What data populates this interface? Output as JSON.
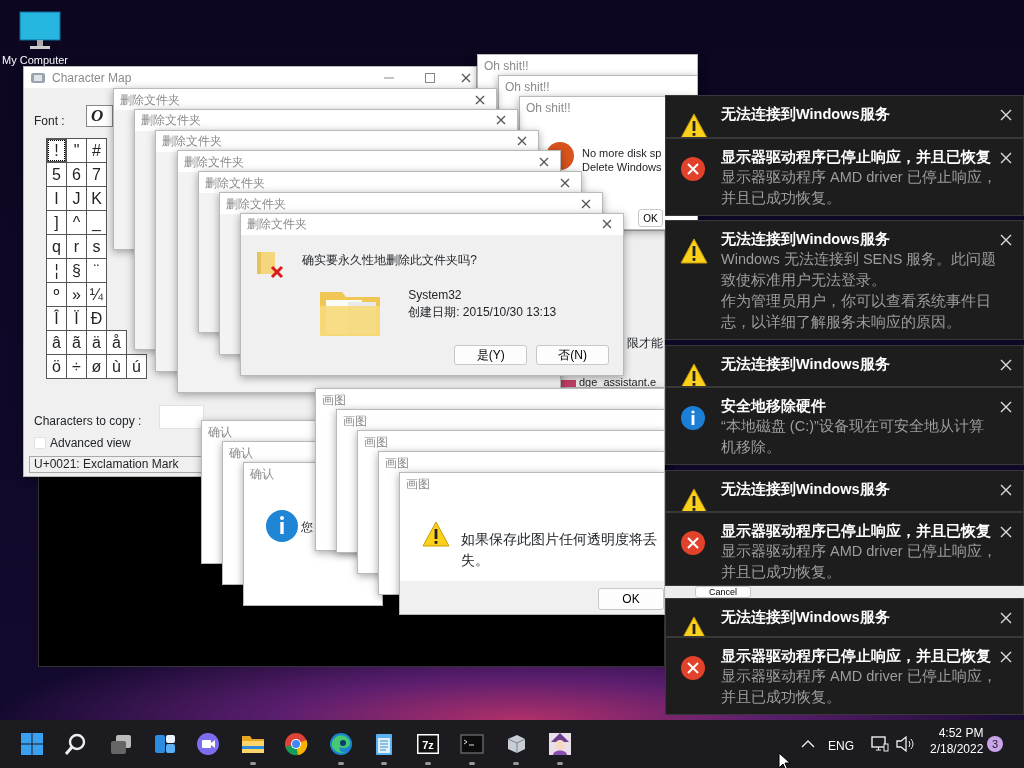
{
  "desktop_icon": {
    "label": "My Computer"
  },
  "character_map": {
    "title": "Character Map",
    "font_label": "Font :",
    "font_value": "O",
    "grid": [
      [
        {
          "char": "!",
          "selected": true
        },
        {
          "char": "\"",
          "selected": false
        },
        {
          "char": "#",
          "selected": false
        }
      ],
      [
        {
          "char": "5",
          "selected": false
        },
        {
          "char": "6",
          "selected": false
        },
        {
          "char": "7",
          "selected": false
        }
      ],
      [
        {
          "char": "I",
          "selected": false
        },
        {
          "char": "J",
          "selected": false
        },
        {
          "char": "K",
          "selected": false
        }
      ],
      [
        {
          "char": "]",
          "selected": false
        },
        {
          "char": "^",
          "selected": false
        },
        {
          "char": "_",
          "selected": false
        }
      ],
      [
        {
          "char": "q",
          "selected": false
        },
        {
          "char": "r",
          "selected": false
        },
        {
          "char": "s",
          "selected": false
        }
      ],
      [
        {
          "char": "¦",
          "selected": false
        },
        {
          "char": "§",
          "selected": false
        },
        {
          "char": "¨",
          "selected": false
        }
      ],
      [
        {
          "char": "º",
          "selected": false
        },
        {
          "char": "»",
          "selected": false
        },
        {
          "char": "¼",
          "selected": false
        }
      ],
      [
        {
          "char": "Î",
          "selected": false
        },
        {
          "char": "Ï",
          "selected": false
        },
        {
          "char": "Ð",
          "selected": false
        }
      ],
      [
        {
          "char": "â",
          "selected": false
        },
        {
          "char": "ã",
          "selected": false
        },
        {
          "char": "ä",
          "selected": false
        },
        {
          "char": "å",
          "selected": false
        }
      ],
      [
        {
          "char": "ö",
          "selected": false
        },
        {
          "char": "÷",
          "selected": false
        },
        {
          "char": "ø",
          "selected": false
        },
        {
          "char": "ù",
          "selected": false
        },
        {
          "char": "ú",
          "selected": false
        }
      ]
    ],
    "copy_label": "Characters to copy :",
    "advanced_view": {
      "label": "Advanced view",
      "checked": false
    },
    "status": "U+0021: Exclamation Mark"
  },
  "background_window": {
    "line_1": "限才能",
    "line_2": "dge_assistant.e"
  },
  "oh_shit_dialogs": [
    {
      "title": "Oh shit!!"
    },
    {
      "title": "Oh shit!!"
    },
    {
      "title": "Oh shit!!",
      "message_lines": [
        "No more disk sp",
        "Delete Windows"
      ],
      "button": "OK"
    }
  ],
  "delete_dialogs": [
    {
      "title": "删除文件夹"
    },
    {
      "title": "删除文件夹"
    },
    {
      "title": "删除文件夹"
    },
    {
      "title": "删除文件夹"
    },
    {
      "title": "删除文件夹"
    },
    {
      "title": "删除文件夹"
    },
    {
      "title": "删除文件夹",
      "question": "确实要永久性地删除此文件夹吗?",
      "item_name": "System32",
      "item_date": "创建日期: 2015/10/30 13:13",
      "buttons": [
        "是(Y)",
        "否(N)"
      ]
    }
  ],
  "confirm_dialogs": [
    {
      "title": "确认"
    },
    {
      "title": "确认"
    },
    {
      "title": "确认",
      "message": "您"
    }
  ],
  "paint_dialogs": [
    {
      "title": "画图"
    },
    {
      "title": "画图"
    },
    {
      "title": "画图"
    },
    {
      "title": "画图"
    },
    {
      "title": "画图",
      "message": "如果保存此图片任何透明度将丢失。",
      "button": "OK"
    }
  ],
  "hidden_button": {
    "label": "Cancel"
  },
  "notifications": [
    {
      "kind": "warning",
      "title": "无法连接到Windows服务"
    },
    {
      "kind": "error",
      "title": "显示器驱动程序已停止响应，并且已恢复",
      "body": "显示器驱动程序 AMD driver 已停止响应，并且已成功恢复。"
    },
    {
      "kind": "warning",
      "title": "无法连接到Windows服务",
      "body": "Windows 无法连接到 SENS 服务。此问题致使标准用户无法登录。",
      "body_2": "作为管理员用户，你可以查看系统事件日志，以详细了解服务未响应的原因。"
    },
    {
      "kind": "warning",
      "title": "无法连接到Windows服务"
    },
    {
      "kind": "info",
      "title": "安全地移除硬件",
      "body": "“本地磁盘 (C:)”设备现在可安全地从计算机移除。"
    },
    {
      "kind": "warning",
      "title": "无法连接到Windows服务"
    },
    {
      "kind": "error",
      "title": "显示器驱动程序已停止响应，并且已恢复",
      "body": "显示器驱动程序 AMD driver 已停止响应，并且已成功恢复。"
    },
    {
      "kind": "warning",
      "title": "无法连接到Windows服务"
    },
    {
      "kind": "error",
      "title": "显示器驱动程序已停止响应，并且已恢复",
      "body": "显示器驱动程序 AMD driver 已停止响应，并且已成功恢复。"
    }
  ],
  "taskbar": {
    "apps": [
      {
        "kind": "start",
        "running": false
      },
      {
        "kind": "search",
        "running": false
      },
      {
        "kind": "taskview",
        "running": false
      },
      {
        "kind": "widgets",
        "running": false
      },
      {
        "kind": "chat",
        "running": false
      },
      {
        "kind": "explorer",
        "running": true
      },
      {
        "kind": "chrome",
        "running": false
      },
      {
        "kind": "edge",
        "running": true
      },
      {
        "kind": "notepad",
        "running": true
      },
      {
        "kind": "archiver",
        "label": "7z",
        "running": true
      },
      {
        "kind": "terminal",
        "running": true
      },
      {
        "kind": "charmap",
        "running": true
      },
      {
        "kind": "figure",
        "running": true
      }
    ],
    "language": "ENG",
    "time": "4:52 PM",
    "date": "2/18/2022",
    "notification_count": "3"
  }
}
